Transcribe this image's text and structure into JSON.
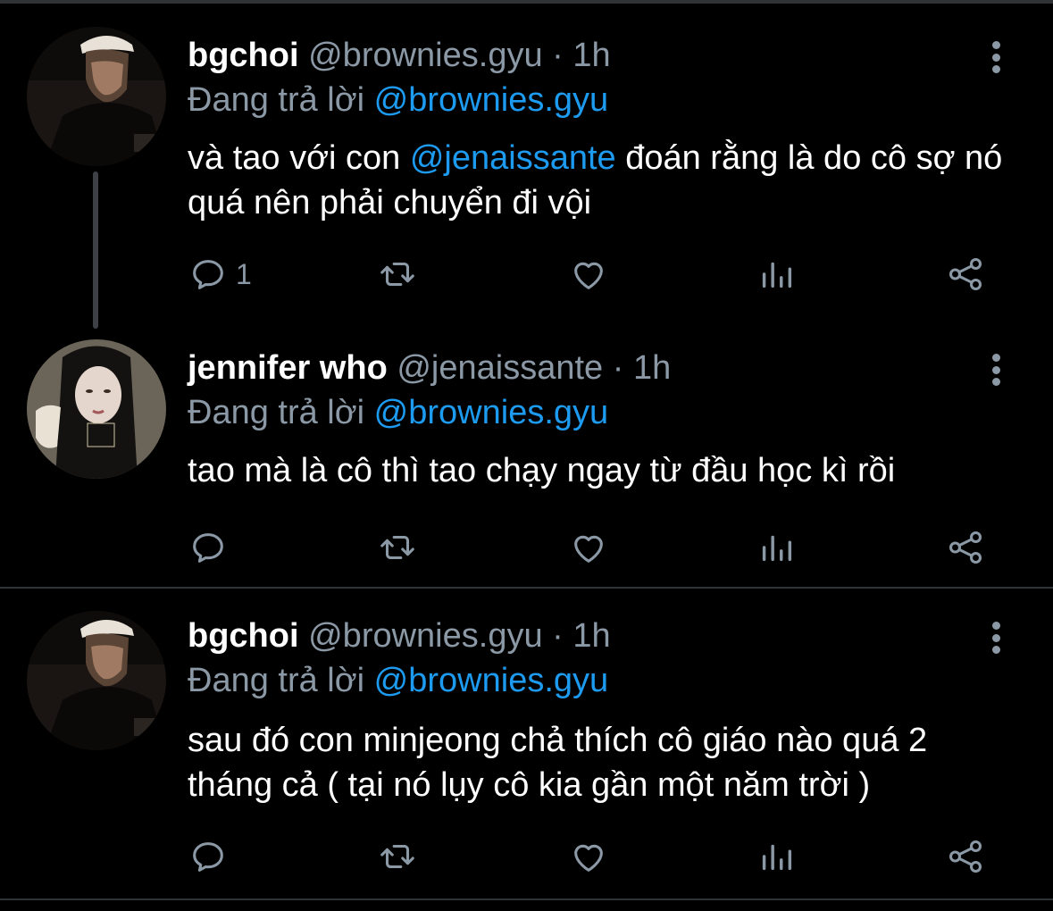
{
  "tweets": [
    {
      "name": "bgchoi",
      "handle": "@brownies.gyu",
      "dot": "·",
      "time": "1h",
      "reply_prefix": "Đang trả lời",
      "reply_to": "@brownies.gyu",
      "text_before": "và tao với con ",
      "mention": "@jenaissante",
      "text_after": " đoán rằng là do cô sợ nó quá nên phải chuyển đi vội",
      "reply_count": "1",
      "avatar": "user-avatar-cap"
    },
    {
      "name": "jennifer who",
      "handle": "@jenaissante",
      "dot": "·",
      "time": "1h",
      "reply_prefix": "Đang trả lời",
      "reply_to": "@brownies.gyu",
      "text": "tao mà là cô thì tao chạy ngay từ đầu học kì rồi",
      "reply_count": "",
      "avatar": "user-avatar-girl"
    },
    {
      "name": "bgchoi",
      "handle": "@brownies.gyu",
      "dot": "·",
      "time": "1h",
      "reply_prefix": "Đang trả lời",
      "reply_to": "@brownies.gyu",
      "text": "sau đó con minjeong chả thích cô giáo nào quá 2 tháng cả ( tại nó lụy cô kia gần một năm trời )",
      "reply_count": "",
      "avatar": "user-avatar-cap"
    }
  ],
  "icons": {
    "reply": "reply-icon",
    "retweet": "retweet-icon",
    "like": "like-icon",
    "views": "views-icon",
    "share": "share-icon",
    "more": "more-icon"
  },
  "colors": {
    "background": "#000000",
    "muted": "#8b98a5",
    "link": "#1d9bf0",
    "divider": "#2f3336"
  }
}
